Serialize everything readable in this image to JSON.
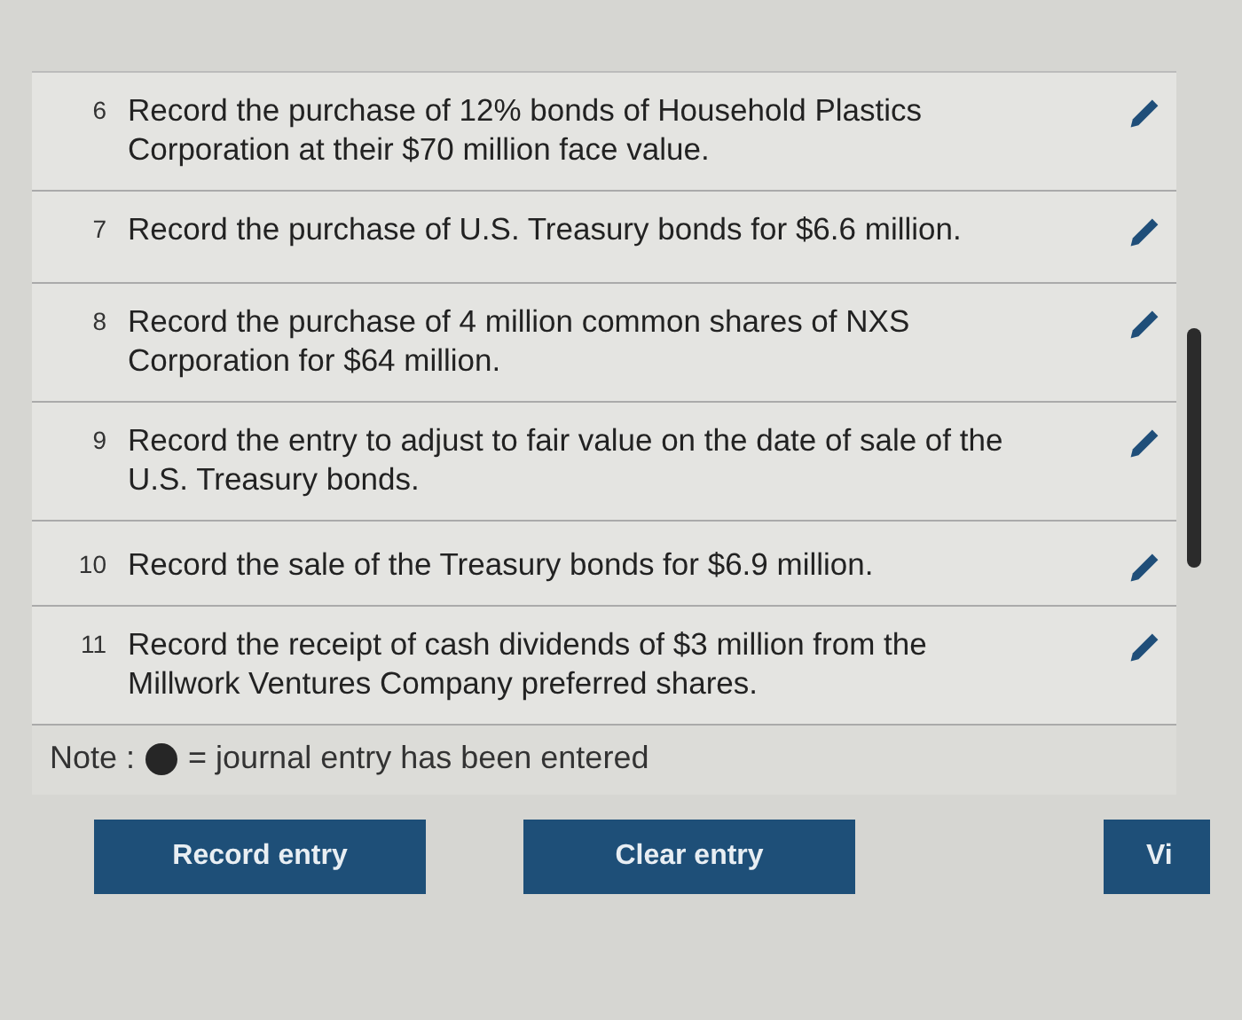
{
  "entries": [
    {
      "number": "6",
      "text": "Record the purchase of 12% bonds of Household Plastics Corporation at their $70 million face value."
    },
    {
      "number": "7",
      "text": "Record the purchase of U.S. Treasury bonds for $6.6 million."
    },
    {
      "number": "8",
      "text": "Record the purchase of 4 million common shares of NXS Corporation for $64 million."
    },
    {
      "number": "9",
      "text": "Record the entry to adjust to fair value on the date of sale of the U.S. Treasury bonds."
    },
    {
      "number": "10",
      "text": "Record the sale of the Treasury bonds for $6.9 million."
    },
    {
      "number": "11",
      "text": "Record the receipt of cash dividends of $3 million from the Millwork Ventures Company preferred shares."
    }
  ],
  "note": {
    "label": "Note :",
    "text": "= journal entry has been entered"
  },
  "buttons": [
    "Record entry",
    "Clear entry",
    "Vi"
  ]
}
